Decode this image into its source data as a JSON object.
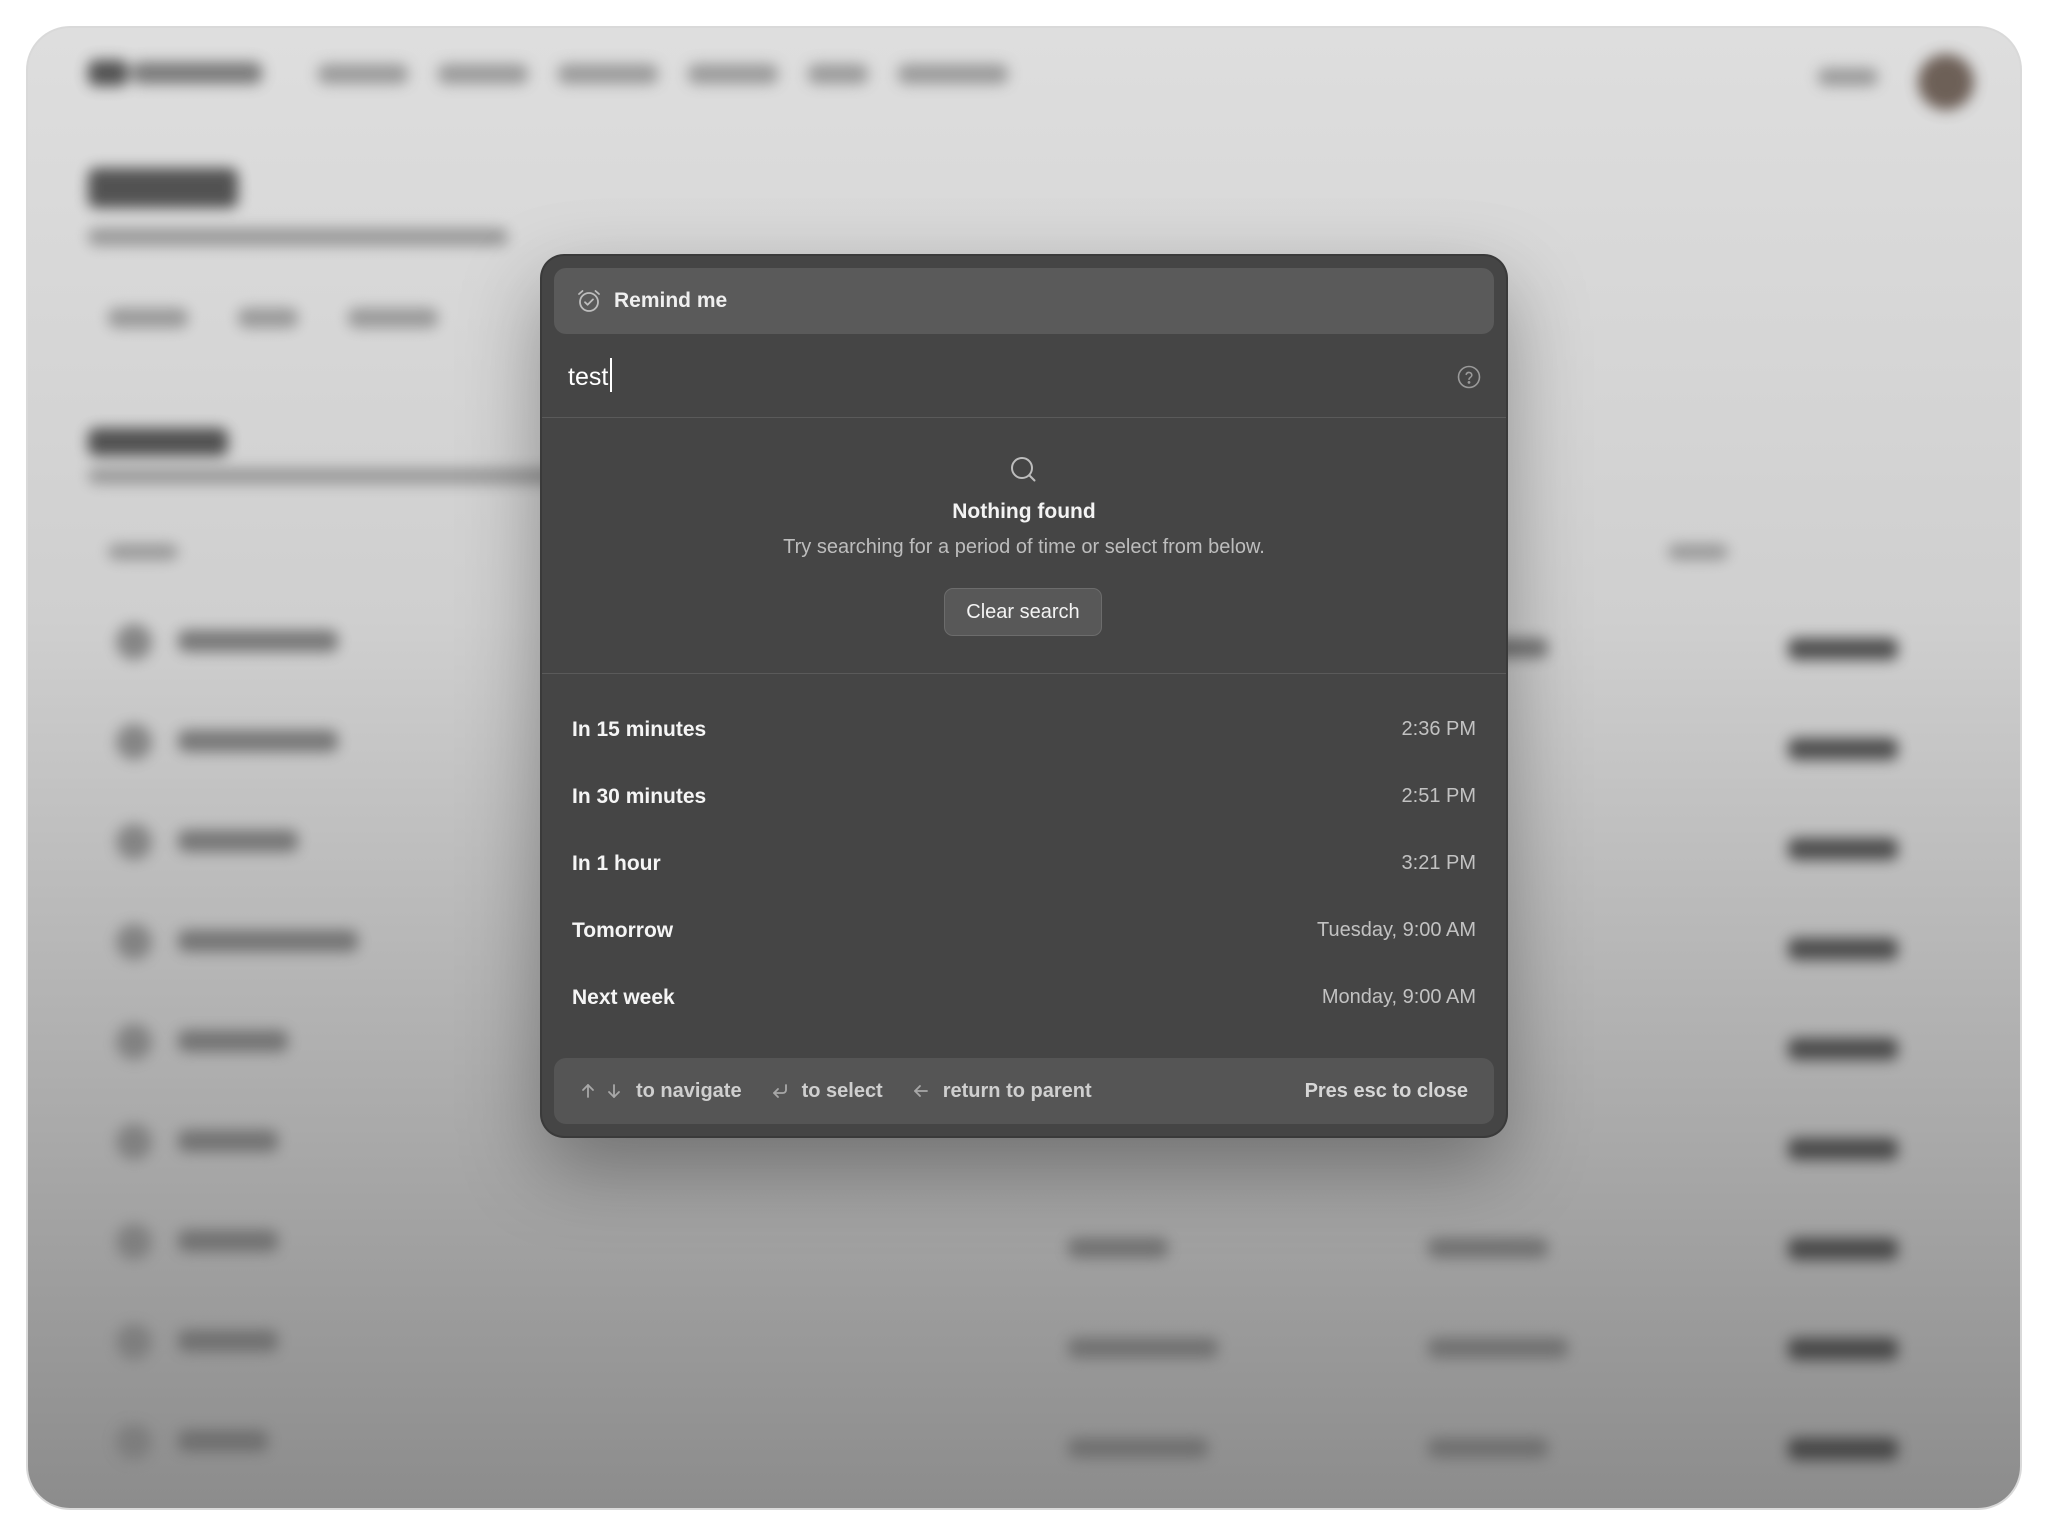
{
  "modal": {
    "header_title": "Remind me",
    "search": {
      "value": "test",
      "placeholder": ""
    },
    "empty_state": {
      "title": "Nothing found",
      "subtitle": "Try searching for a period of time or select from below.",
      "clear_button": "Clear search"
    },
    "options": [
      {
        "label": "In 15 minutes",
        "time": "2:36 PM"
      },
      {
        "label": "In 30 minutes",
        "time": "2:51 PM"
      },
      {
        "label": "In 1 hour",
        "time": "3:21 PM"
      },
      {
        "label": "Tomorrow",
        "time": "Tuesday, 9:00 AM"
      },
      {
        "label": "Next week",
        "time": "Monday, 9:00 AM"
      }
    ],
    "footer": {
      "navigate": "to navigate",
      "select": "to select",
      "parent": "return to parent",
      "close": "Pres esc to close"
    }
  },
  "icons": {
    "header": "alarm-clock-icon",
    "help": "help-circle-icon",
    "empty": "search-icon",
    "up": "arrow-up-icon",
    "down": "arrow-down-icon",
    "enter": "enter-icon",
    "back": "arrow-left-icon"
  },
  "colors": {
    "modal_bg": "#454545",
    "header_bg": "#5a5a5a",
    "footer_bg": "#555555",
    "text_primary": "#f5f5f5",
    "text_secondary": "#c2c2c2"
  }
}
